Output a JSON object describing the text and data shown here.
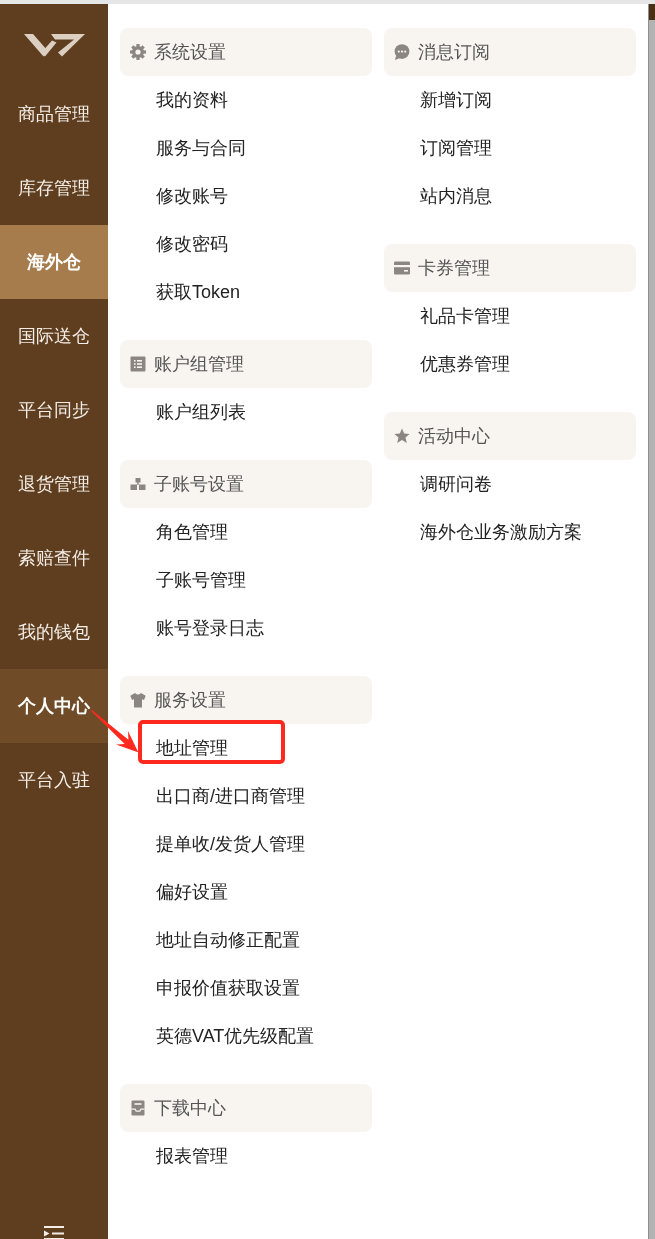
{
  "sidebar": {
    "items": [
      {
        "label": "商品管理",
        "selected": false,
        "open": false
      },
      {
        "label": "库存管理",
        "selected": false,
        "open": false
      },
      {
        "label": "海外仓",
        "selected": true,
        "open": false
      },
      {
        "label": "国际送仓",
        "selected": false,
        "open": false
      },
      {
        "label": "平台同步",
        "selected": false,
        "open": false
      },
      {
        "label": "退货管理",
        "selected": false,
        "open": false
      },
      {
        "label": "索赔查件",
        "selected": false,
        "open": false
      },
      {
        "label": "我的钱包",
        "selected": false,
        "open": false
      },
      {
        "label": "个人中心",
        "selected": false,
        "open": true
      },
      {
        "label": "平台入驻",
        "selected": false,
        "open": false
      }
    ]
  },
  "menu": {
    "columns": [
      {
        "sections": [
          {
            "kind": "settings",
            "title": "系统设置",
            "items": [
              {
                "label": "我的资料",
                "highlighted": false
              },
              {
                "label": "服务与合同",
                "highlighted": false
              },
              {
                "label": "修改账号",
                "highlighted": false
              },
              {
                "label": "修改密码",
                "highlighted": false
              },
              {
                "label": "获取Token",
                "highlighted": false
              }
            ]
          },
          {
            "kind": "groups",
            "title": "账户组管理",
            "items": [
              {
                "label": "账户组列表",
                "highlighted": false
              }
            ]
          },
          {
            "kind": "subaccounts",
            "title": "子账号设置",
            "items": [
              {
                "label": "角色管理",
                "highlighted": false
              },
              {
                "label": "子账号管理",
                "highlighted": false
              },
              {
                "label": "账号登录日志",
                "highlighted": false
              }
            ]
          },
          {
            "kind": "services",
            "title": "服务设置",
            "items": [
              {
                "label": "地址管理",
                "highlighted": true
              },
              {
                "label": "出口商/进口商管理",
                "highlighted": false
              },
              {
                "label": "提单收/发货人管理",
                "highlighted": false
              },
              {
                "label": "偏好设置",
                "highlighted": false
              },
              {
                "label": "地址自动修正配置",
                "highlighted": false
              },
              {
                "label": "申报价值获取设置",
                "highlighted": false
              },
              {
                "label": "英德VAT优先级配置",
                "highlighted": false
              }
            ]
          },
          {
            "kind": "downloads",
            "title": "下载中心",
            "items": [
              {
                "label": "报表管理",
                "highlighted": false
              }
            ]
          }
        ]
      },
      {
        "sections": [
          {
            "kind": "messages",
            "title": "消息订阅",
            "items": [
              {
                "label": "新增订阅",
                "highlighted": false
              },
              {
                "label": "订阅管理",
                "highlighted": false
              },
              {
                "label": "站内消息",
                "highlighted": false
              }
            ]
          },
          {
            "kind": "cards",
            "title": "卡券管理",
            "items": [
              {
                "label": "礼品卡管理",
                "highlighted": false
              },
              {
                "label": "优惠券管理",
                "highlighted": false
              }
            ]
          },
          {
            "kind": "activities",
            "title": "活动中心",
            "items": [
              {
                "label": "调研问卷",
                "highlighted": false
              },
              {
                "label": "海外仓业务激励方案",
                "highlighted": false
              }
            ]
          }
        ]
      }
    ]
  },
  "annotation_arrow": true
}
